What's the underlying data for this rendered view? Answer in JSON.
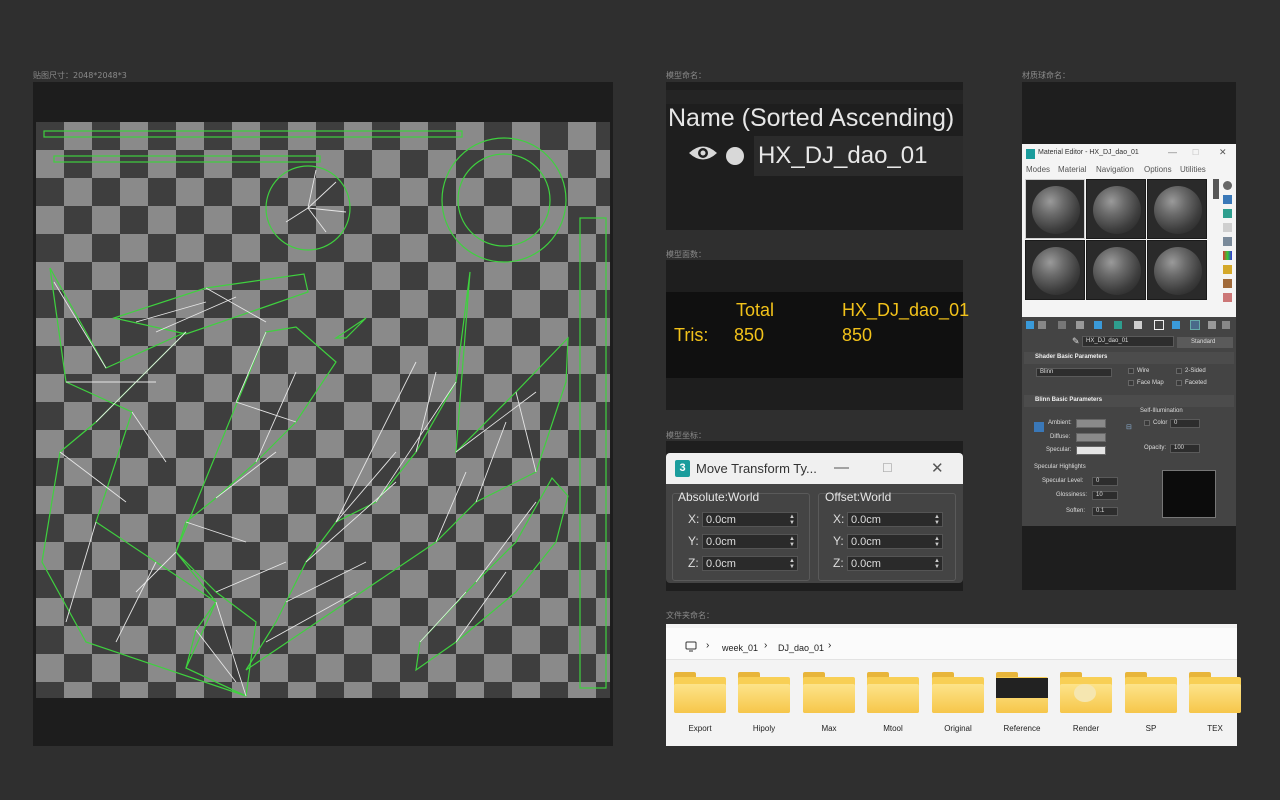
{
  "captions": {
    "texture": "贴图尺寸：2048*2048*3",
    "model_name": "模型命名：",
    "face_count": "模型面数：",
    "coords": "模型坐标：",
    "folder_name": "文件夹命名：",
    "material_name": "材质球命名："
  },
  "scene_explorer": {
    "column_header": "Name (Sorted Ascending)",
    "object_name": "HX_DJ_dao_01",
    "icons": [
      "eye-icon",
      "circle-icon"
    ]
  },
  "stats": {
    "col_total": "Total",
    "col_object": "HX_DJ_dao_01",
    "row_label": "Tris:",
    "total_value": "850",
    "object_value": "850",
    "text_color": "#f2c21a"
  },
  "move_transform": {
    "title": "Move Transform Ty...",
    "absolute_title": "Absolute:World",
    "offset_title": "Offset:World",
    "absolute": [
      {
        "axis": "X:",
        "value": "0.0cm"
      },
      {
        "axis": "Y:",
        "value": "0.0cm"
      },
      {
        "axis": "Z:",
        "value": "0.0cm"
      }
    ],
    "offset": [
      {
        "axis": "X:",
        "value": "0.0cm"
      },
      {
        "axis": "Y:",
        "value": "0.0cm"
      },
      {
        "axis": "Z:",
        "value": "0.0cm"
      }
    ]
  },
  "explorer": {
    "breadcrumb": [
      "week_01",
      "DJ_dao_01"
    ],
    "folders": [
      "Export",
      "Hipoly",
      "Max",
      "Mtool",
      "Original",
      "Reference",
      "Render",
      "SP",
      "TEX"
    ]
  },
  "material_editor": {
    "title": "Material Editor - HX_DJ_dao_01",
    "menu": [
      "Modes",
      "Material",
      "Navigation",
      "Options",
      "Utilities"
    ],
    "material_name": "HX_DJ_dao_01",
    "material_type": "Standard",
    "shader_rollout": "Shader Basic Parameters",
    "shader": "Blinn",
    "wire": "Wire",
    "two_sided": "2-Sided",
    "face_map": "Face Map",
    "faceted": "Faceted",
    "blinn_rollout": "Blinn Basic Parameters",
    "self_illum": "Self-Illumination",
    "color_label": "Color",
    "color_value": "0",
    "ambient": "Ambient:",
    "diffuse": "Diffuse:",
    "specular": "Specular:",
    "opacity_label": "Opacity:",
    "opacity_value": "100",
    "spec_highlights": "Specular Highlights",
    "spec_level_label": "Specular Level:",
    "spec_level": "0",
    "glossiness_label": "Glossiness:",
    "glossiness": "10",
    "soften_label": "Soften:",
    "soften": "0.1"
  }
}
